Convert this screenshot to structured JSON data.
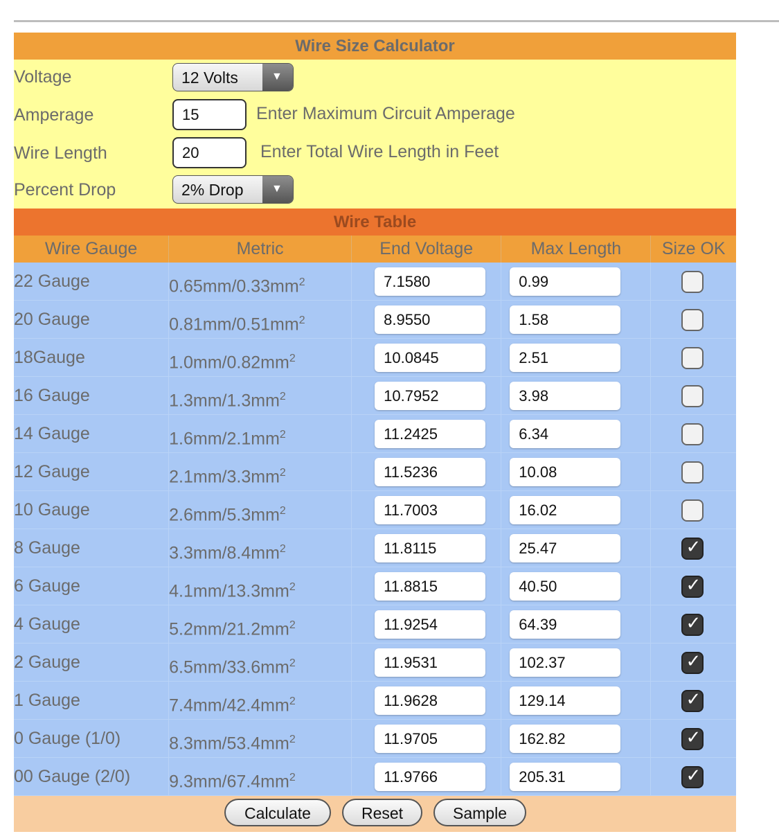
{
  "title": "Wire Size Calculator",
  "voltage": {
    "label": "Voltage",
    "value": "12 Volts"
  },
  "amperage": {
    "label": "Amperage",
    "value": "15",
    "hint": "Enter Maximum Circuit Amperage"
  },
  "wire_length": {
    "label": "Wire Length",
    "value": "20",
    "hint": "Enter Total Wire Length in Feet"
  },
  "percent_drop": {
    "label": "Percent Drop",
    "value": "2% Drop"
  },
  "table": {
    "title": "Wire Table",
    "headers": [
      "Wire Gauge",
      "Metric",
      "End Voltage",
      "Max Length",
      "Size OK"
    ],
    "rows": [
      {
        "gauge": "22 Gauge",
        "metric": "0.65mm/0.33mm",
        "end_voltage": "7.1580",
        "max_length": "0.99",
        "ok": false
      },
      {
        "gauge": "20 Gauge",
        "metric": "0.81mm/0.51mm",
        "end_voltage": "8.9550",
        "max_length": "1.58",
        "ok": false
      },
      {
        "gauge": "18Gauge",
        "metric": "1.0mm/0.82mm",
        "end_voltage": "10.0845",
        "max_length": "2.51",
        "ok": false
      },
      {
        "gauge": "16 Gauge",
        "metric": "1.3mm/1.3mm",
        "end_voltage": "10.7952",
        "max_length": "3.98",
        "ok": false
      },
      {
        "gauge": "14 Gauge",
        "metric": "1.6mm/2.1mm",
        "end_voltage": "11.2425",
        "max_length": "6.34",
        "ok": false
      },
      {
        "gauge": "12 Gauge",
        "metric": "2.1mm/3.3mm",
        "end_voltage": "11.5236",
        "max_length": "10.08",
        "ok": false
      },
      {
        "gauge": "10 Gauge",
        "metric": "2.6mm/5.3mm",
        "end_voltage": "11.7003",
        "max_length": "16.02",
        "ok": false
      },
      {
        "gauge": "8 Gauge",
        "metric": "3.3mm/8.4mm",
        "end_voltage": "11.8115",
        "max_length": "25.47",
        "ok": true
      },
      {
        "gauge": "6 Gauge",
        "metric": "4.1mm/13.3mm",
        "end_voltage": "11.8815",
        "max_length": "40.50",
        "ok": true
      },
      {
        "gauge": "4 Gauge",
        "metric": "5.2mm/21.2mm",
        "end_voltage": "11.9254",
        "max_length": "64.39",
        "ok": true
      },
      {
        "gauge": "2 Gauge",
        "metric": "6.5mm/33.6mm",
        "end_voltage": "11.9531",
        "max_length": "102.37",
        "ok": true
      },
      {
        "gauge": "1 Gauge",
        "metric": "7.4mm/42.4mm",
        "end_voltage": "11.9628",
        "max_length": "129.14",
        "ok": true
      },
      {
        "gauge": "0 Gauge (1/0)",
        "metric": "8.3mm/53.4mm",
        "end_voltage": "11.9705",
        "max_length": "162.82",
        "ok": true
      },
      {
        "gauge": "00 Gauge (2/0)",
        "metric": "9.3mm/67.4mm",
        "end_voltage": "11.9766",
        "max_length": "205.31",
        "ok": true
      }
    ],
    "metric_superscript": "2"
  },
  "buttons": {
    "calculate": "Calculate",
    "reset": "Reset",
    "sample": "Sample"
  },
  "icons": {
    "dropdown": "chevron-down-icon",
    "check": "checkmark-icon"
  },
  "colors": {
    "title_bar": "#f0a03a",
    "input_panel": "#fffe9c",
    "table_title": "#ec742e",
    "table_body": "#a9c8f5",
    "footer": "#f8cda0"
  }
}
